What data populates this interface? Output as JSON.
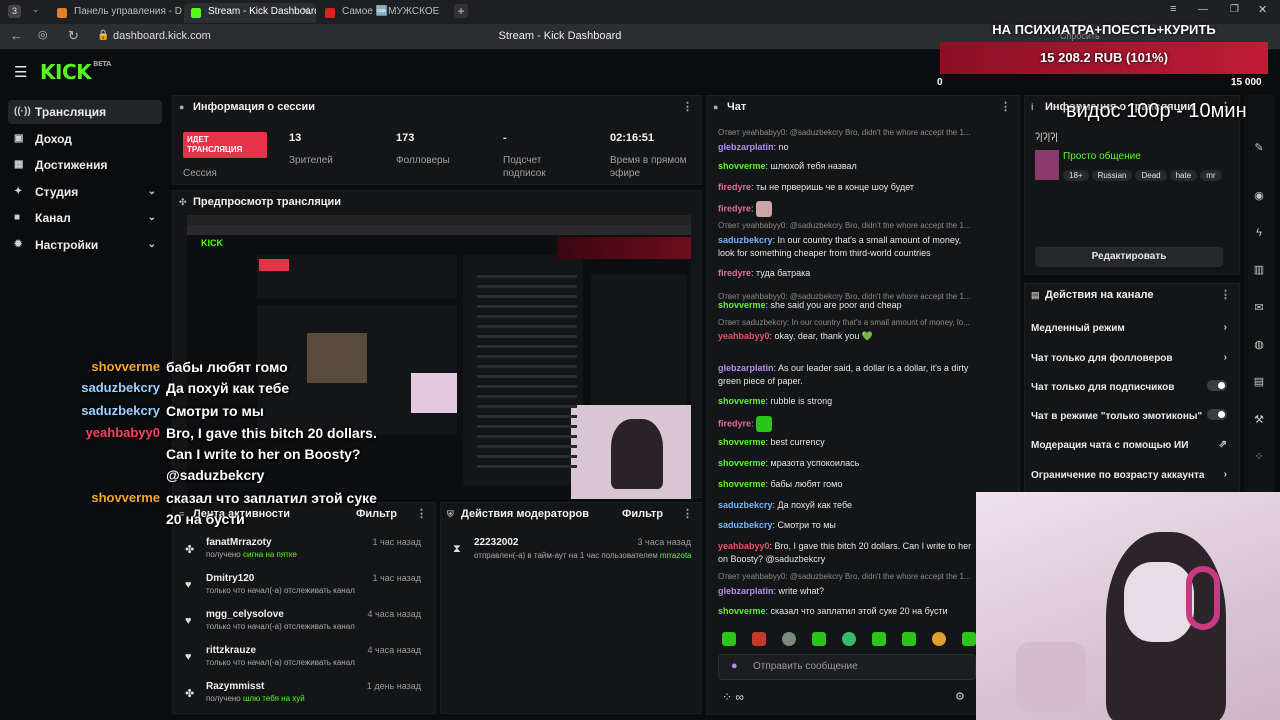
{
  "browser": {
    "tabs": [
      {
        "title": "Панель управления - Don"
      },
      {
        "title": "Stream - Kick Dashboard"
      },
      {
        "title": "Самое 🆒МУЖСКОЕ"
      }
    ],
    "url": "dashboard.kick.com",
    "page_title": "Stream - Kick Dashboard",
    "assistant_label": "Спросить"
  },
  "app": {
    "logo": "KICK",
    "logo_badge": "BETA"
  },
  "sidebar": {
    "items": [
      {
        "label": "Трансляция",
        "icon": "broadcast-icon"
      },
      {
        "label": "Доход",
        "icon": "dollar-icon"
      },
      {
        "label": "Достижения",
        "icon": "trophy-icon"
      },
      {
        "label": "Студия",
        "icon": "studio-icon"
      },
      {
        "label": "Канал",
        "icon": "channel-icon"
      },
      {
        "label": "Настройки",
        "icon": "gear-icon"
      }
    ]
  },
  "session": {
    "title": "Информация о сессии",
    "live_badge": "ИДЕТ ТРАНСЛЯЦИЯ",
    "session_label": "Сессия",
    "stats": [
      {
        "value": "13",
        "label": "Зрителей"
      },
      {
        "value": "173",
        "label": "Фолловеры"
      },
      {
        "value": "-",
        "label": "Подсчет подписок"
      },
      {
        "value": "02:16:51",
        "label": "Время в прямом эфире"
      }
    ]
  },
  "preview": {
    "title": "Предпросмотр трансляции"
  },
  "activity": {
    "title": "Лента активности",
    "filter": "Фильтр",
    "items": [
      {
        "user": "fanatMrrazoty",
        "time": "1 час назад",
        "desc": "получено ",
        "highlight": "сигна на пятке"
      },
      {
        "user": "Dmitry120",
        "time": "1 час назад",
        "desc": "только что начал(-а) отслеживать канал",
        "highlight": ""
      },
      {
        "user": "mgg_celysolove",
        "time": "4 часа назад",
        "desc": "только что начал(-а) отслеживать канал",
        "highlight": ""
      },
      {
        "user": "rittzkrauze",
        "time": "4 часа назад",
        "desc": "только что начал(-а) отслеживать канал",
        "highlight": ""
      },
      {
        "user": "Razymmisst",
        "time": "1 день назад",
        "desc": "получено ",
        "highlight": "шлю тебя на хуй"
      }
    ]
  },
  "moderators": {
    "title": "Действия модераторов",
    "filter": "Фильтр",
    "item": {
      "user": "22232002",
      "time": "3 часа назад",
      "desc": "отправлен(-а) в тайм-аут на 1 час пользователем",
      "by": "mrrazota"
    }
  },
  "chat": {
    "title": "Чат",
    "input_placeholder": "Отправить сообщение",
    "lines": [
      {
        "reply": "Ответ yeahbabyy0: @saduzbekcry Bro, didn't the whore accept the 1...",
        "user": "glebzarplatin",
        "color": "purple",
        "text": "no"
      },
      {
        "reply": "",
        "user": "shovverme",
        "color": "green",
        "text": "шлюхой тебя назвал"
      },
      {
        "reply": "",
        "user": "firedyre",
        "color": "pink",
        "text": "ты не прверишь че в конце шоу будет"
      },
      {
        "reply": "",
        "user": "firedyre",
        "color": "pink",
        "text": ""
      },
      {
        "reply": "Ответ yeahbabyy0: @saduzbekcry Bro, didn't the whore accept the 1...",
        "user": "saduzbekcry",
        "color": "blue",
        "text": "In our country that's a small amount of money, look for something cheaper from third-world countries"
      },
      {
        "reply": "",
        "user": "firedyre",
        "color": "pink",
        "text": "туда батрака"
      },
      {
        "reply": "Ответ yeahbabyy0: @saduzbekcry Bro, didn't the whore accept the 1...",
        "user": "shovverme",
        "color": "green",
        "text": "she said you are poor and cheap"
      },
      {
        "reply": "Ответ saduzbekcry: In our country that's a small amount of money, lo...",
        "user": "yeahbabyy0",
        "color": "red",
        "text": "okay, dear, thank you 💚"
      },
      {
        "reply": "",
        "user": "glebzarplatin",
        "color": "purple",
        "text": "As our leader said, a dollar is a dollar, it's a dirty green piece of paper."
      },
      {
        "reply": "",
        "user": "shovverme",
        "color": "green",
        "text": "rubble is strong"
      },
      {
        "reply": "",
        "user": "firedyre",
        "color": "pink",
        "text": ""
      },
      {
        "reply": "",
        "user": "shovverme",
        "color": "green",
        "text": "best currency"
      },
      {
        "reply": "",
        "user": "shovverme",
        "color": "green",
        "text": "мразота успокоилась"
      },
      {
        "reply": "",
        "user": "shovverme",
        "color": "green",
        "text": "бабы любят гомо"
      },
      {
        "reply": "",
        "user": "saduzbekcry",
        "color": "blue",
        "text": "Да похуй как тебе"
      },
      {
        "reply": "",
        "user": "saduzbekcry",
        "color": "blue",
        "text": "Смотри то мы"
      },
      {
        "reply": "",
        "user": "yeahbabyy0",
        "color": "red",
        "text": "Bro, I gave this bitch 20 dollars. Can I write to her on Boosty? @saduzbekcry"
      },
      {
        "reply": "Ответ yeahbabyy0: @saduzbekcry Bro, didn't the whore accept the 1...",
        "user": "glebzarplatin",
        "color": "purple",
        "text": "write what?"
      },
      {
        "reply": "",
        "user": "shovverme",
        "color": "green",
        "text": "сказал что заплатил этой суке 20 на бусти"
      }
    ]
  },
  "stream_info": {
    "title": "Информация о трансляции",
    "stream_title": "ʔ|ʔ|ʔ|",
    "category": "Просто общение",
    "tags": [
      "18+",
      "Russian",
      "Dead",
      "hate",
      "mr"
    ],
    "edit_button": "Редактировать"
  },
  "channel_actions": {
    "title": "Действия на канале",
    "items": [
      {
        "label": "Медленный режим",
        "control": "arrow"
      },
      {
        "label": "Чат только для фолловеров",
        "control": "arrow"
      },
      {
        "label": "Чат только для подписчиков",
        "control": "toggle"
      },
      {
        "label": "Чат в режиме \"только эмотиконы\"",
        "control": "toggle"
      },
      {
        "label": "Модерация чата с помощью ИИ",
        "control": "external"
      },
      {
        "label": "Ограничение по возрасту аккаунта",
        "control": "arrow"
      }
    ]
  },
  "overlay": {
    "banner": "НА ПСИХИАТРА+ПОЕСТЬ+КУРИТЬ",
    "goal": "15 208.2 RUB (101%)",
    "goal_progress": 1.0,
    "goal_min": "0",
    "goal_max": "15 000",
    "video_promo": "видос 100р - 10мин",
    "chat": [
      {
        "user": "shovverme",
        "color": "#f5a623",
        "text": "бабы любят гомо"
      },
      {
        "user": "saduzbekcry",
        "color": "#9bd0ff",
        "text": "Да похуй как тебе"
      },
      {
        "user": "saduzbekcry",
        "color": "#9bd0ff",
        "text": "Смотри то мы"
      },
      {
        "user": "yeahbabyy0",
        "color": "#ff4060",
        "text": "Bro, I gave this bitch 20 dollars."
      },
      {
        "user": "",
        "color": "#ffffff",
        "text": "Can I write to her on Boosty?"
      },
      {
        "user": "",
        "color": "#ffffff",
        "text": "@saduzbekcry"
      },
      {
        "user": "shovverme",
        "color": "#f5a623",
        "text": "сказал что заплатил этой суке"
      },
      {
        "user": "",
        "color": "#ffffff",
        "text": "20 на бусти"
      }
    ]
  }
}
